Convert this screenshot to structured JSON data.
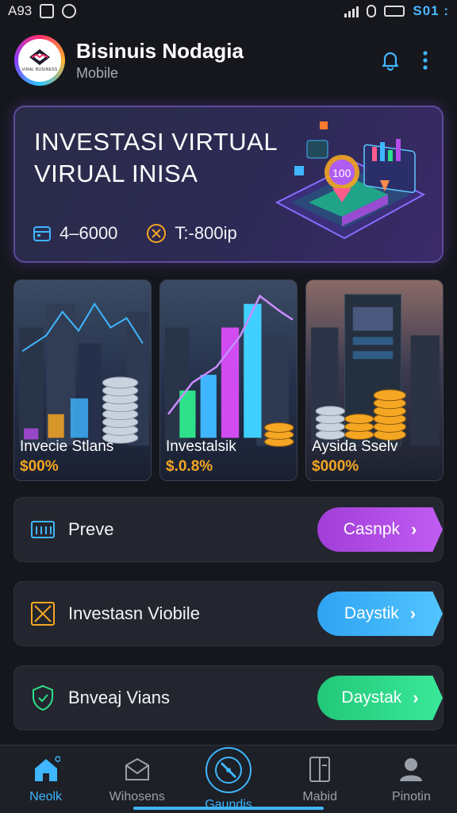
{
  "status_bar": {
    "left_text": "A93",
    "time": "S01 :"
  },
  "header": {
    "title": "Bisinuis Nodagia",
    "subtitle": "Mobile",
    "logo_caption": "VIRAL BUSINESS"
  },
  "hero": {
    "title_line1": "INVESTASI VIRTUAL",
    "title_line2": "VIRUAL INISA",
    "stat1": "4–6000",
    "stat2": "T:-800ip",
    "art_label": "100"
  },
  "cards": [
    {
      "title": "Invecie Stlans",
      "value": "$00%",
      "value_color": "#f5a623"
    },
    {
      "title": "Investalsik",
      "value": "$.0.8%",
      "value_color": "#f5a623"
    },
    {
      "title": "Aysida Sselv",
      "value": "$000%",
      "value_color": "#f5a623"
    }
  ],
  "rows": [
    {
      "label": "Preve",
      "button": "Casnpk",
      "icon": "calendar-icon",
      "accent": "#b54ce8"
    },
    {
      "label": "Investasn Viobile",
      "button": "Daystik",
      "icon": "chart-box-icon",
      "accent": "#3ab4ff"
    },
    {
      "label": "Bnveaj Vians",
      "button": "Daystak",
      "icon": "shield-icon",
      "accent": "#2ee08a"
    }
  ],
  "nav": [
    {
      "label": "Neolk",
      "icon": "home-icon"
    },
    {
      "label": "Wihosens",
      "icon": "mail-icon"
    },
    {
      "label": "Gaundis",
      "icon": "compass-icon"
    },
    {
      "label": "Mabid",
      "icon": "wallet-icon"
    },
    {
      "label": "Pinotin",
      "icon": "profile-icon"
    }
  ],
  "colors": {
    "accent_blue": "#3fb6ff",
    "gold": "#f5a623",
    "purple": "#b54ce8",
    "green": "#2ee08a"
  }
}
